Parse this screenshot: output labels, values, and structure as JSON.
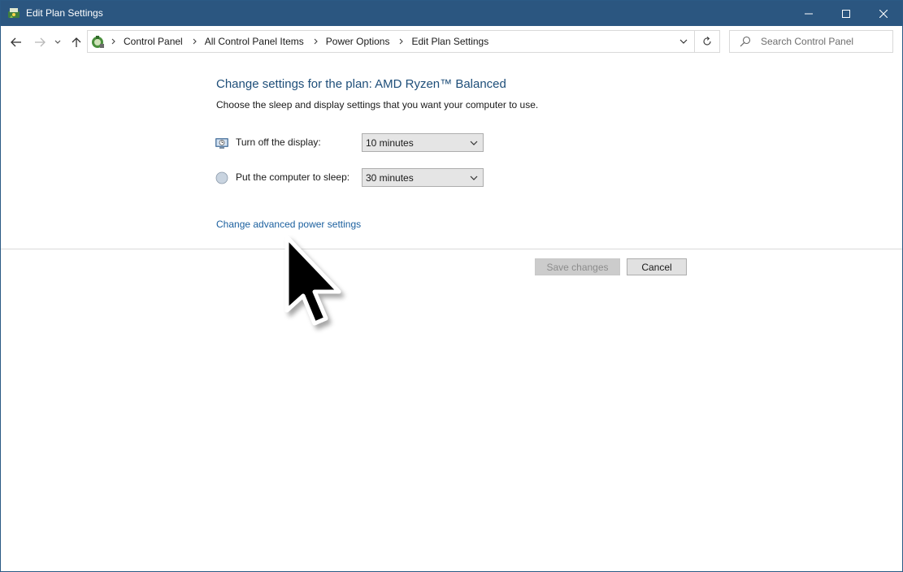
{
  "window": {
    "title": "Edit Plan Settings",
    "icon": "power-options-icon",
    "controls": [
      "minimize-icon",
      "maximize-icon",
      "close-icon"
    ]
  },
  "nav": {
    "back_icon": "arrow-left-icon",
    "forward_icon": "arrow-right-icon",
    "recent_icon": "chevron-down-icon",
    "up_icon": "arrow-up-icon"
  },
  "address": {
    "crumbs": [
      "Control Panel",
      "All Control Panel Items",
      "Power Options",
      "Edit Plan Settings"
    ],
    "icon": "control-panel-icon",
    "refresh_icon": "refresh-icon"
  },
  "search": {
    "placeholder": "Search Control Panel",
    "icon": "search-icon"
  },
  "main": {
    "heading": "Change settings for the plan: AMD Ryzen™ Balanced",
    "subtext": "Choose the sleep and display settings that you want your computer to use.",
    "settings": [
      {
        "label": "Turn off the display:",
        "value": "10 minutes",
        "icon": "monitor-icon"
      },
      {
        "label": "Put the computer to sleep:",
        "value": "30 minutes",
        "icon": "moon-icon"
      }
    ],
    "advanced_link": "Change advanced power settings",
    "save_button": "Save changes",
    "cancel_button": "Cancel"
  },
  "colors": {
    "titlebar": "#2b5680",
    "heading": "#1e4e79",
    "link": "#1a5f9e"
  }
}
